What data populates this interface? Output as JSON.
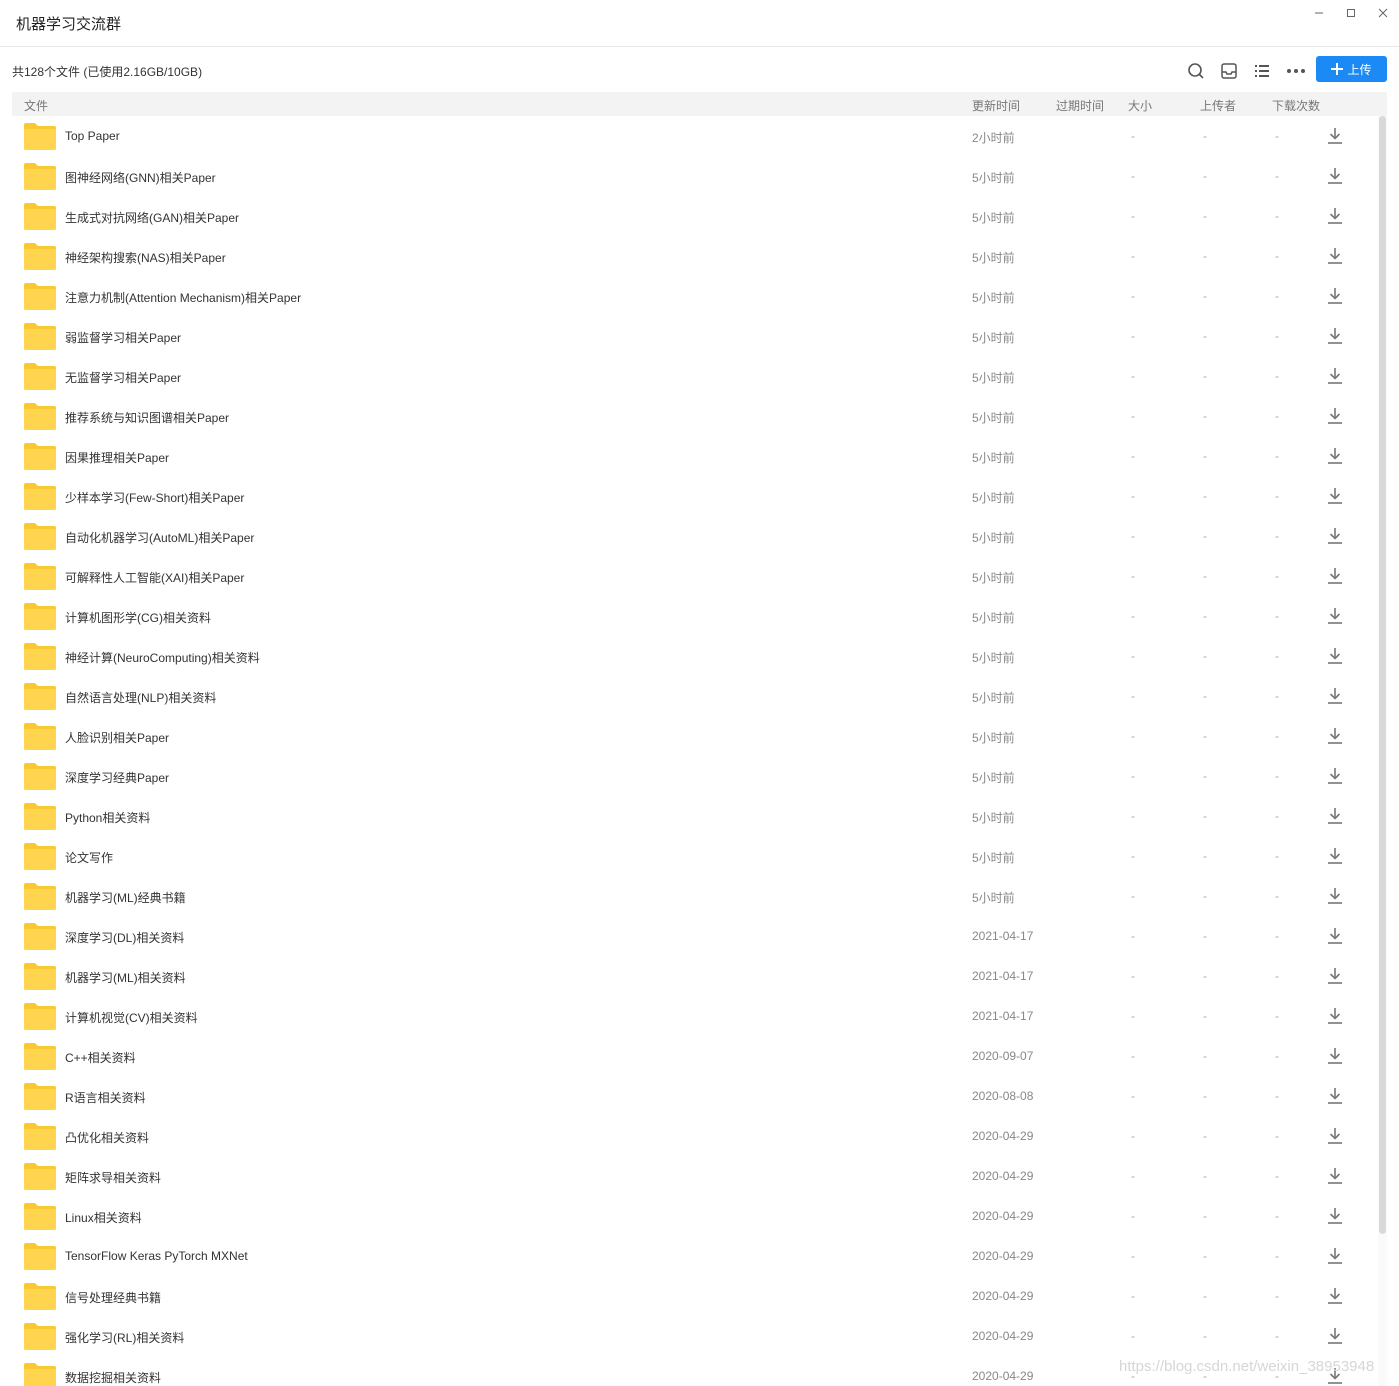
{
  "window": {
    "title": "机器学习交流群"
  },
  "toolbar": {
    "summary": "共128个文件 (已使用2.16GB/10GB)",
    "upload_label": "上传"
  },
  "columns": {
    "file": "文件",
    "updated": "更新时间",
    "expires": "过期时间",
    "size": "大小",
    "uploader": "上传者",
    "downloads": "下载次数"
  },
  "colors": {
    "accent": "#1b8af5",
    "folder": "#ffd54f",
    "folder_tab": "#f9c932"
  },
  "files": [
    {
      "name": "Top Paper",
      "updated": "2小时前",
      "expires": "",
      "size": "-",
      "uploader": "-",
      "downloads": "-"
    },
    {
      "name": "图神经网络(GNN)相关Paper",
      "updated": "5小时前",
      "expires": "",
      "size": "-",
      "uploader": "-",
      "downloads": "-"
    },
    {
      "name": "生成式对抗网络(GAN)相关Paper",
      "updated": "5小时前",
      "expires": "",
      "size": "-",
      "uploader": "-",
      "downloads": "-"
    },
    {
      "name": "神经架构搜索(NAS)相关Paper",
      "updated": "5小时前",
      "expires": "",
      "size": "-",
      "uploader": "-",
      "downloads": "-"
    },
    {
      "name": "注意力机制(Attention Mechanism)相关Paper",
      "updated": "5小时前",
      "expires": "",
      "size": "-",
      "uploader": "-",
      "downloads": "-"
    },
    {
      "name": "弱监督学习相关Paper",
      "updated": "5小时前",
      "expires": "",
      "size": "-",
      "uploader": "-",
      "downloads": "-"
    },
    {
      "name": "无监督学习相关Paper",
      "updated": "5小时前",
      "expires": "",
      "size": "-",
      "uploader": "-",
      "downloads": "-"
    },
    {
      "name": "推荐系统与知识图谱相关Paper",
      "updated": "5小时前",
      "expires": "",
      "size": "-",
      "uploader": "-",
      "downloads": "-"
    },
    {
      "name": "因果推理相关Paper",
      "updated": "5小时前",
      "expires": "",
      "size": "-",
      "uploader": "-",
      "downloads": "-"
    },
    {
      "name": "少样本学习(Few-Short)相关Paper",
      "updated": "5小时前",
      "expires": "",
      "size": "-",
      "uploader": "-",
      "downloads": "-"
    },
    {
      "name": "自动化机器学习(AutoML)相关Paper",
      "updated": "5小时前",
      "expires": "",
      "size": "-",
      "uploader": "-",
      "downloads": "-"
    },
    {
      "name": "可解释性人工智能(XAI)相关Paper",
      "updated": "5小时前",
      "expires": "",
      "size": "-",
      "uploader": "-",
      "downloads": "-"
    },
    {
      "name": "计算机图形学(CG)相关资料",
      "updated": "5小时前",
      "expires": "",
      "size": "-",
      "uploader": "-",
      "downloads": "-"
    },
    {
      "name": "神经计算(NeuroComputing)相关资料",
      "updated": "5小时前",
      "expires": "",
      "size": "-",
      "uploader": "-",
      "downloads": "-"
    },
    {
      "name": "自然语言处理(NLP)相关资料",
      "updated": "5小时前",
      "expires": "",
      "size": "-",
      "uploader": "-",
      "downloads": "-"
    },
    {
      "name": "人脸识别相关Paper",
      "updated": "5小时前",
      "expires": "",
      "size": "-",
      "uploader": "-",
      "downloads": "-"
    },
    {
      "name": "深度学习经典Paper",
      "updated": "5小时前",
      "expires": "",
      "size": "-",
      "uploader": "-",
      "downloads": "-"
    },
    {
      "name": "Python相关资料",
      "updated": "5小时前",
      "expires": "",
      "size": "-",
      "uploader": "-",
      "downloads": "-"
    },
    {
      "name": "论文写作",
      "updated": "5小时前",
      "expires": "",
      "size": "-",
      "uploader": "-",
      "downloads": "-"
    },
    {
      "name": "机器学习(ML)经典书籍",
      "updated": "5小时前",
      "expires": "",
      "size": "-",
      "uploader": "-",
      "downloads": "-"
    },
    {
      "name": "深度学习(DL)相关资料",
      "updated": "2021-04-17",
      "expires": "",
      "size": "-",
      "uploader": "-",
      "downloads": "-"
    },
    {
      "name": "机器学习(ML)相关资料",
      "updated": "2021-04-17",
      "expires": "",
      "size": "-",
      "uploader": "-",
      "downloads": "-"
    },
    {
      "name": "计算机视觉(CV)相关资料",
      "updated": "2021-04-17",
      "expires": "",
      "size": "-",
      "uploader": "-",
      "downloads": "-"
    },
    {
      "name": "C++相关资料",
      "updated": "2020-09-07",
      "expires": "",
      "size": "-",
      "uploader": "-",
      "downloads": "-"
    },
    {
      "name": "R语言相关资料",
      "updated": "2020-08-08",
      "expires": "",
      "size": "-",
      "uploader": "-",
      "downloads": "-"
    },
    {
      "name": "凸优化相关资料",
      "updated": "2020-04-29",
      "expires": "",
      "size": "-",
      "uploader": "-",
      "downloads": "-"
    },
    {
      "name": "矩阵求导相关资料",
      "updated": "2020-04-29",
      "expires": "",
      "size": "-",
      "uploader": "-",
      "downloads": "-"
    },
    {
      "name": "Linux相关资料",
      "updated": "2020-04-29",
      "expires": "",
      "size": "-",
      "uploader": "-",
      "downloads": "-"
    },
    {
      "name": "TensorFlow Keras PyTorch MXNet",
      "updated": "2020-04-29",
      "expires": "",
      "size": "-",
      "uploader": "-",
      "downloads": "-"
    },
    {
      "name": "信号处理经典书籍",
      "updated": "2020-04-29",
      "expires": "",
      "size": "-",
      "uploader": "-",
      "downloads": "-"
    },
    {
      "name": "强化学习(RL)相关资料",
      "updated": "2020-04-29",
      "expires": "",
      "size": "-",
      "uploader": "-",
      "downloads": "-"
    },
    {
      "name": "数据挖掘相关资料",
      "updated": "2020-04-29",
      "expires": "",
      "size": "-",
      "uploader": "-",
      "downloads": "-"
    }
  ],
  "watermark": "https://blog.csdn.net/weixin_38953948"
}
